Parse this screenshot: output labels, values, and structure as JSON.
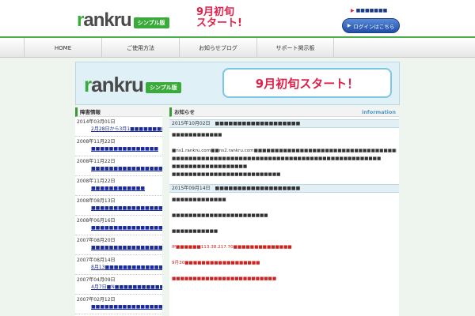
{
  "header": {
    "logo_text_first": "r",
    "logo_text_rest": "ankru",
    "logo_badge": "シンプル版",
    "announce_line1": "9月初旬",
    "announce_line2": "スタート!",
    "top_link": "■■■■■■■",
    "login_label": "ログインはこちら"
  },
  "nav": {
    "items": [
      "HOME",
      "ご使用方法",
      "お知らせブログ",
      "サポート掲示板"
    ]
  },
  "banner": {
    "logo_text_first": "r",
    "logo_text_rest": "ankru",
    "logo_badge": "シンプル版",
    "announce": "9月初旬スタート！"
  },
  "left": {
    "heading": "障害情報",
    "items": [
      {
        "date": "2014年03月01日",
        "title": "2月28日から3月1■■■■■■■■■■■■"
      },
      {
        "date": "2008年11月22日",
        "title": "■■■■■■■■■■■■■■■"
      },
      {
        "date": "2008年11月22日",
        "title": "■■■■■■■■■■■■■■■■■■■■■■■"
      },
      {
        "date": "2008年11月22日",
        "title": "■■■■■■■■■■■■"
      },
      {
        "date": "2008年08月13日",
        "title": "■■■■■■■■■■■■■■■■■■■■"
      },
      {
        "date": "2008年06月16日",
        "title": "■■■■■■■■■■■■■■■■"
      },
      {
        "date": "2007年08月20日",
        "title": "■■■■■■■■■■■■■■■■"
      },
      {
        "date": "2007年08月14日",
        "title": "8月13■■■■■■■■■■■■■■■■■"
      },
      {
        "date": "2007年04月09日",
        "title": "4月7日■N■■■■■■■■■■■■■■"
      },
      {
        "date": "2007年02月12日",
        "title": "■■■■■■■■■■■■■■■■"
      }
    ]
  },
  "right": {
    "heading": "お知らせ",
    "tag": "information",
    "news": [
      {
        "date": "2015年10月02日",
        "title": "■■■■■■■■■■■■■■■■■■■",
        "lines": [
          "■■■■■■■■■■■■",
          "",
          "■ns1.rankru.com■■ns2.rankru.com■■■■■■■■■■■■■■■■■■■■■■■■■■■■■■■■■■■■■■",
          "■■■■■■■■■■■■■■■■■■■■■■■■■■■■■■■■■■■■■■■■■■■■■■■■■■",
          "■■■■■■■■■■■■■■■■■■",
          "■■■■■■■■■■■■■■■■■■■■■■■■■■"
        ]
      },
      {
        "date": "2015年09月14日",
        "title": "■■■■■■■■■■■■■■■■■■■",
        "lines": [
          "■■■■■■■■■■■■■",
          "",
          "■■■■■■■■■■■■■■■■■■■■■■■",
          "",
          "■■■■■■■■■■■",
          "",
          "IP■■■■■■113.38.217.70■■■■■■■■■■■■■■",
          "",
          "9月30■■■■■■■■■■■■■■■■■■",
          "",
          "■■■■■■■■■■■■■■■■■■■■■■■■■"
        ],
        "red_lines": [
          6,
          8,
          10
        ]
      }
    ]
  },
  "colors": {
    "brand_green": "#3aaa3a",
    "accent_red": "#e0224a",
    "link_blue": "#1a2a9a",
    "info_blue": "#4a9ac8"
  }
}
